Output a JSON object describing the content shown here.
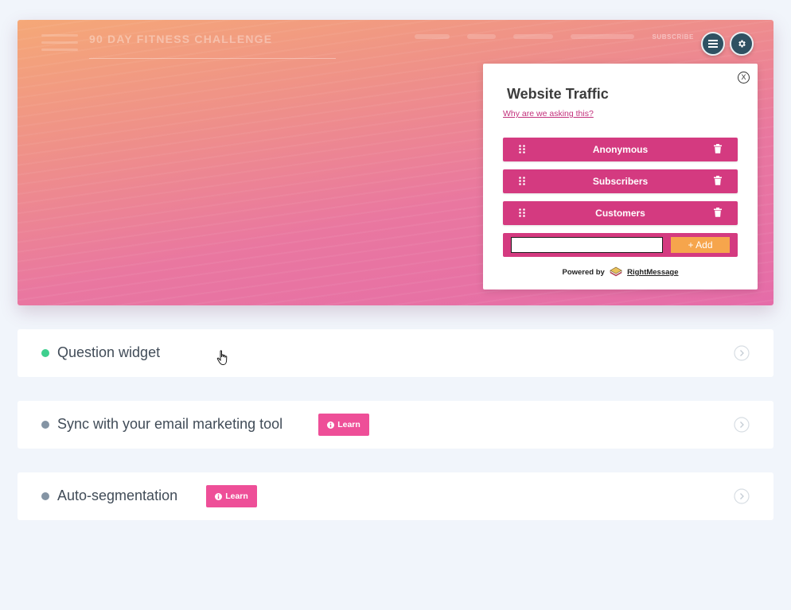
{
  "site": {
    "title": "90 DAY FITNESS CHALLENGE",
    "nav_subscribe": "SUBSCRIBE"
  },
  "toolbar": {
    "menu_icon": "hamburger-menu-icon",
    "settings_icon": "gear-icon"
  },
  "widget": {
    "close_label": "X",
    "title": "Website Traffic",
    "why_link": "Why are we asking this?",
    "options": [
      {
        "label": "Anonymous"
      },
      {
        "label": "Subscribers"
      },
      {
        "label": "Customers"
      }
    ],
    "add_input_value": "",
    "add_button": "+ Add",
    "powered_by": "Powered by",
    "brand": "RightMessage"
  },
  "features": [
    {
      "label": "Question widget",
      "status_color": "#3ecf8e",
      "learn": null
    },
    {
      "label": "Sync with your email marketing tool",
      "status_color": "#8494a4",
      "learn": "Learn"
    },
    {
      "label": "Auto-segmentation",
      "status_color": "#8494a4",
      "learn": "Learn"
    }
  ],
  "colors": {
    "accent_pink": "#d43a80",
    "learn_pink": "#ee4f98",
    "add_orange": "#f6a54c",
    "round_button": "#2f5162"
  }
}
